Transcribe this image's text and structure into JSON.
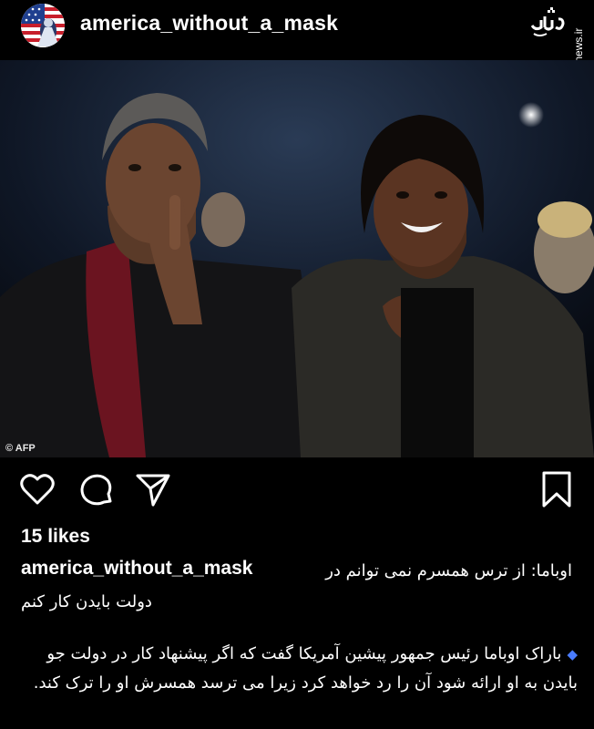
{
  "post": {
    "username": "america_without_a_mask",
    "likes": "15 likes",
    "credit": "© AFP",
    "caption_user": "america_without_a_mask",
    "caption_line1": "اوباما: از ترس همسرم نمی توانم در",
    "caption_line2": "دولت بایدن کار کنم",
    "body": "باراک اوباما رئیس جمهور پیشین آمریکا گفت که اگر پیشنهاد کار در دولت جو بایدن به او ارائه شود آن را رد خواهد کرد زیرا می ترسد همسرش او را ترک کند."
  },
  "watermark": {
    "site": "mashreghnews.ir"
  },
  "icons": {
    "like": "heart-icon",
    "comment": "comment-icon",
    "share": "send-icon",
    "save": "bookmark-icon"
  },
  "colors": {
    "background": "#000000",
    "text": "#ffffff",
    "diamond": "#4a7cff"
  }
}
